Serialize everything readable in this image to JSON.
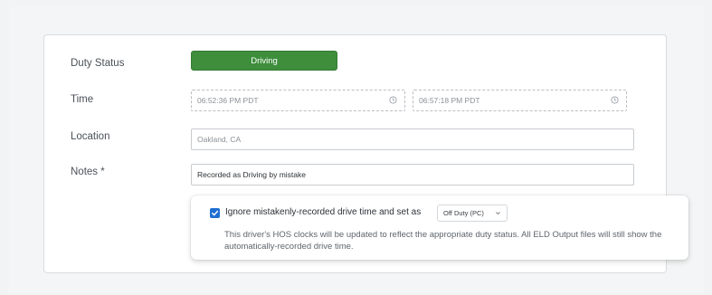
{
  "form": {
    "duty_status_label": "Duty Status",
    "duty_status_value": "Driving",
    "time_label": "Time",
    "time_start": "06:52:36 PM PDT",
    "time_end": "06:57:18 PM PDT",
    "location_label": "Location",
    "location_value": "Oakland, CA",
    "notes_label": "Notes *",
    "notes_value": "Recorded as Driving by mistake"
  },
  "popover": {
    "checkbox_checked": true,
    "main_text": "Ignore mistakenly-recorded drive time and set as",
    "select_value": "Off Duty (PC)",
    "description": "This driver's HOS clocks will be updated to reflect the appropriate duty status. All ELD Output files will still show the automatically-recorded drive time."
  },
  "colors": {
    "status_green": "#3e8e3c",
    "checkbox_blue": "#1f6fd1"
  },
  "icons": {
    "time_start_icon": "clock-icon",
    "time_end_icon": "clock-icon",
    "select_icon": "chevron-down-icon",
    "checkbox_icon": "checkmark-icon"
  }
}
